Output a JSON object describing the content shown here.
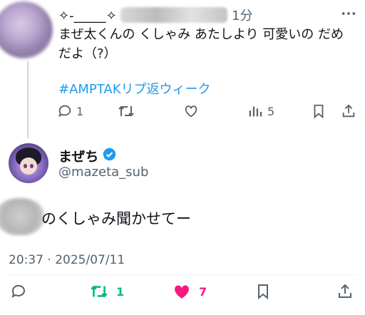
{
  "reply": {
    "header_handle": "✧-_____✧",
    "header_time": "1分",
    "text": "まぜ太くんの くしゃみ あたしより 可愛いの だめだよ（?）",
    "hashtag": "#AMPTAKリプ返ウィーク",
    "reply_count": "1",
    "retweet_count": "",
    "like_count": "",
    "view_count": "5"
  },
  "tweet": {
    "display_name": "まぜち",
    "handle": "@mazeta_sub",
    "text": "のくしゃみ聞かせてー",
    "timestamp": "20:37 · 2025/07/11",
    "retweet_count": "1",
    "like_count": "7"
  },
  "colors": {
    "text": "#0f1419",
    "muted": "#536471",
    "link": "#1d9bf0",
    "retweet_green": "#00ba7c",
    "like_pink": "#f91880",
    "verified_blue": "#1d9bf0"
  },
  "icons": [
    "reply-icon",
    "retweet-icon",
    "like-icon",
    "views-icon",
    "bookmark-icon",
    "share-icon",
    "more-icon",
    "verified-icon"
  ]
}
